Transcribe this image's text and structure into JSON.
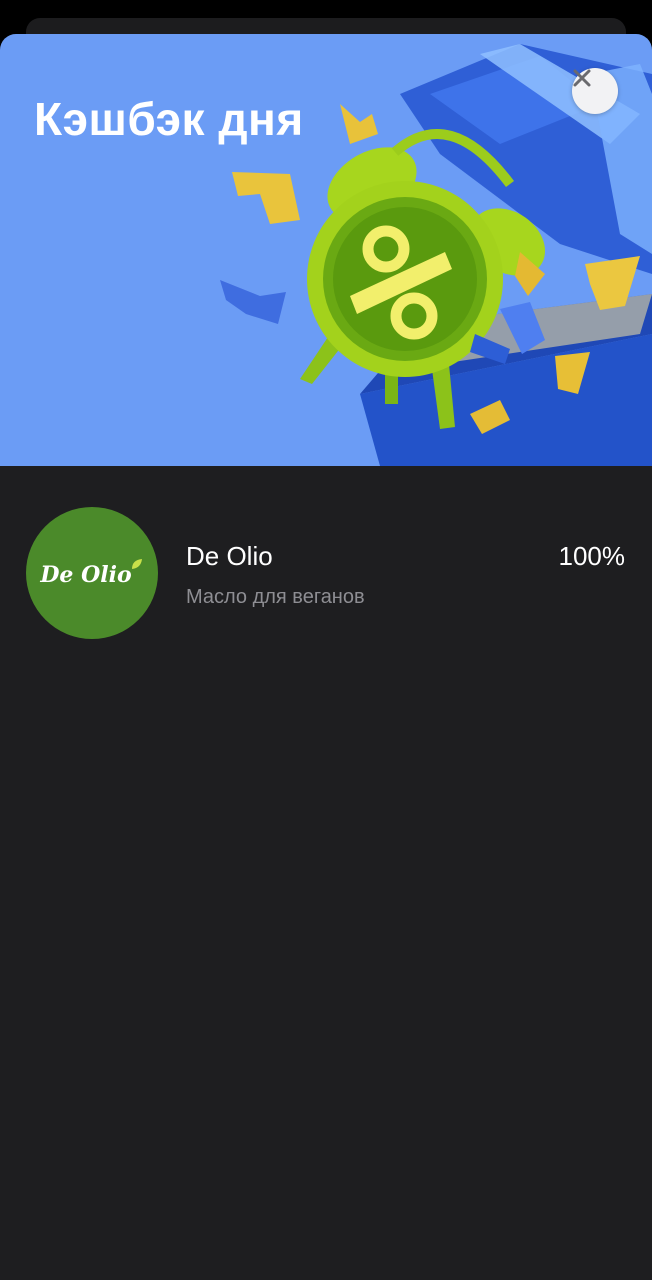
{
  "banner": {
    "title": "Кэшбэк дня",
    "illustration": "alarm-clock-percent-gift-box",
    "background_color": "#6b9cf5"
  },
  "close_button": {
    "icon": "close-icon"
  },
  "merchant": {
    "logo_text": "De Olio",
    "logo_color": "#4b8a2a",
    "name": "De Olio",
    "description": "Масло для веганов",
    "cashback": "100%"
  }
}
